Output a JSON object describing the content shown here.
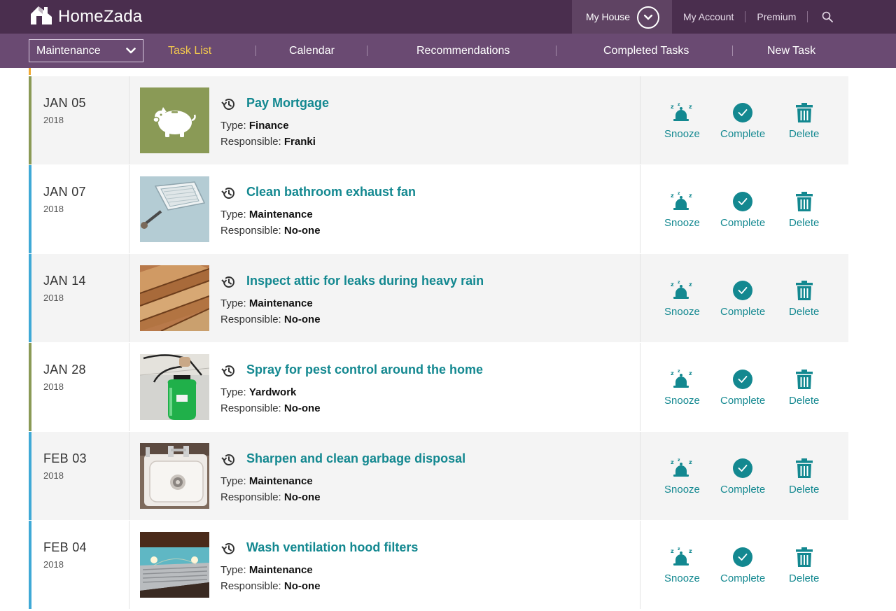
{
  "brand": {
    "name": "HomeZada",
    "logo_icon": "house-logo-icon"
  },
  "topbar": {
    "house": "My House",
    "links": [
      "My Account",
      "Premium"
    ],
    "search_icon": "search-icon"
  },
  "subnav": {
    "category": "Maintenance",
    "items": [
      "Task List",
      "Calendar",
      "Recommendations",
      "Completed Tasks",
      "New Task"
    ],
    "active": "Task List"
  },
  "colors": {
    "teal": "#138890",
    "purple_dark": "#4a2e4e",
    "purple": "#6a4a72",
    "active_nav": "#f3c94d",
    "olive": "#8a9a56",
    "blue": "#3fa9d6"
  },
  "labels": {
    "type": "Type:",
    "responsible": "Responsible:"
  },
  "actions": {
    "snooze": "Snooze",
    "complete": "Complete",
    "delete": "Delete"
  },
  "tasks": [
    {
      "date": "JAN 05",
      "year": "2018",
      "title": "Pay Mortgage",
      "type": "Finance",
      "responsible": "Franki",
      "image": "piggy-bank",
      "accent": "olive"
    },
    {
      "date": "JAN 07",
      "year": "2018",
      "title": "Clean bathroom exhaust fan",
      "type": "Maintenance",
      "responsible": "No-one",
      "image": "exhaust-fan",
      "accent": "blue"
    },
    {
      "date": "JAN 14",
      "year": "2018",
      "title": "Inspect attic for leaks during heavy rain",
      "type": "Maintenance",
      "responsible": "No-one",
      "image": "attic-wood",
      "accent": "blue"
    },
    {
      "date": "JAN 28",
      "year": "2018",
      "title": "Spray for pest control around the home",
      "type": "Yardwork",
      "responsible": "No-one",
      "image": "sprayer",
      "accent": "olive"
    },
    {
      "date": "FEB 03",
      "year": "2018",
      "title": "Sharpen and clean garbage disposal",
      "type": "Maintenance",
      "responsible": "No-one",
      "image": "sink-disposal",
      "accent": "blue"
    },
    {
      "date": "FEB 04",
      "year": "2018",
      "title": "Wash ventilation hood filters",
      "type": "Maintenance",
      "responsible": "No-one",
      "image": "range-hood",
      "accent": "blue"
    }
  ]
}
